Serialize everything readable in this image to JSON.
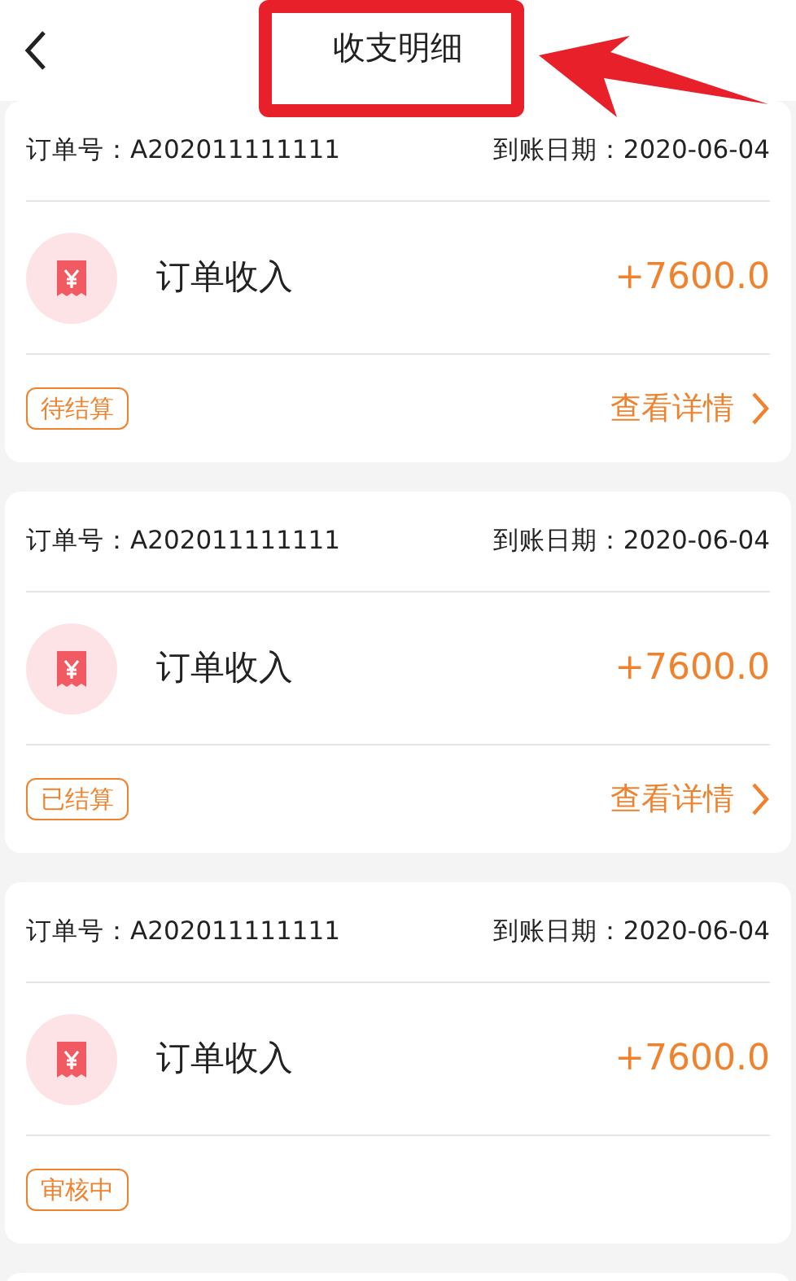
{
  "header": {
    "title": "收支明细"
  },
  "records": [
    {
      "order_no": "订单号：A202011111111",
      "date": "到账日期：2020-06-04",
      "type": "订单收入",
      "amount": "+7600.0",
      "status": "待结算",
      "detail_link": "查看详情"
    },
    {
      "order_no": "订单号：A202011111111",
      "date": "到账日期：2020-06-04",
      "type": "订单收入",
      "amount": "+7600.0",
      "status": "已结算",
      "detail_link": "查看详情"
    },
    {
      "order_no": "订单号：A202011111111",
      "date": "到账日期：2020-06-04",
      "type": "订单收入",
      "amount": "+7600.0",
      "status": "审核中"
    }
  ]
}
